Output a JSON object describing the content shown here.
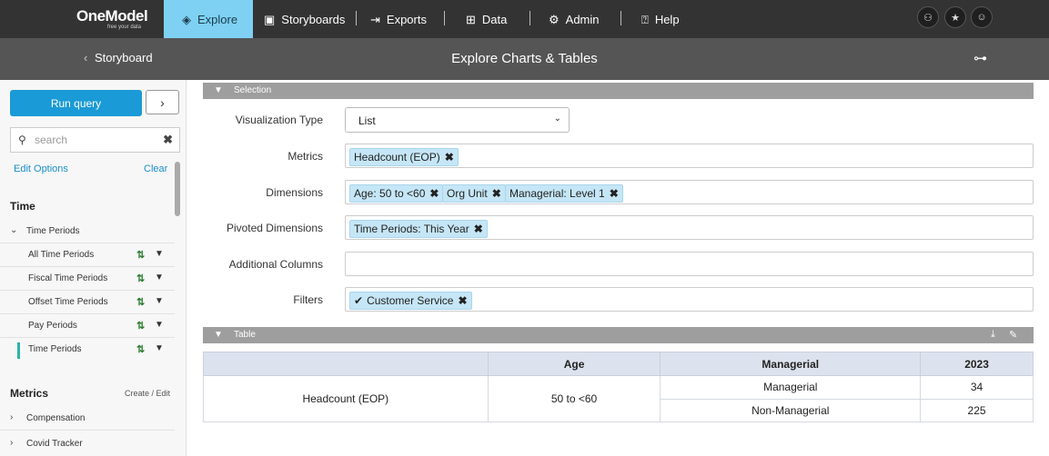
{
  "app": {
    "logo_name": "OneModel",
    "logo_tagline": "free your data"
  },
  "nav": {
    "explore": "Explore",
    "storyboards": "Storyboards",
    "exports": "Exports",
    "data": "Data",
    "admin": "Admin",
    "help": "Help"
  },
  "header": {
    "back_label": "Storyboard",
    "title": "Explore Charts & Tables"
  },
  "sidebar": {
    "run_query": "Run query",
    "search_placeholder": "search",
    "edit_options": "Edit Options",
    "clear": "Clear",
    "time_heading": "Time",
    "time_periods_group": "Time Periods",
    "time_items": [
      {
        "label": "All Time Periods"
      },
      {
        "label": "Fiscal Time Periods"
      },
      {
        "label": "Offset Time Periods"
      },
      {
        "label": "Pay Periods"
      },
      {
        "label": "Time Periods"
      }
    ],
    "metrics_heading": "Metrics",
    "create_edit": "Create / Edit",
    "metric_groups": [
      {
        "label": "Compensation"
      },
      {
        "label": "Covid Tracker"
      }
    ]
  },
  "selection": {
    "bar_label": "Selection",
    "visualization_type_label": "Visualization Type",
    "visualization_type_value": "List",
    "metrics_label": "Metrics",
    "metrics_chips": [
      "Headcount (EOP)"
    ],
    "dimensions_label": "Dimensions",
    "dimensions_chips": [
      "Age: 50 to <60",
      "Org Unit",
      "Managerial: Level 1"
    ],
    "pivoted_label": "Pivoted Dimensions",
    "pivoted_chips": [
      "Time Periods: This Year"
    ],
    "additional_label": "Additional Columns",
    "filters_label": "Filters",
    "filters_chips": [
      "Customer Service"
    ]
  },
  "table": {
    "bar_label": "Table",
    "headers": [
      "",
      "Age",
      "Managerial",
      "2023"
    ],
    "metric": "Headcount (EOP)",
    "age": "50 to <60",
    "rows": [
      {
        "managerial": "Managerial",
        "value": "34"
      },
      {
        "managerial": "Non-Managerial",
        "value": "225"
      }
    ]
  },
  "colors": {
    "nav_bg": "#333333",
    "nav_active": "#7ed1f3",
    "subbar_bg": "#555555",
    "primary_button": "#1a9ad6",
    "chip_bg": "#c5e6f6",
    "section_bar": "#9e9e9e",
    "table_header": "#dde3ee"
  }
}
